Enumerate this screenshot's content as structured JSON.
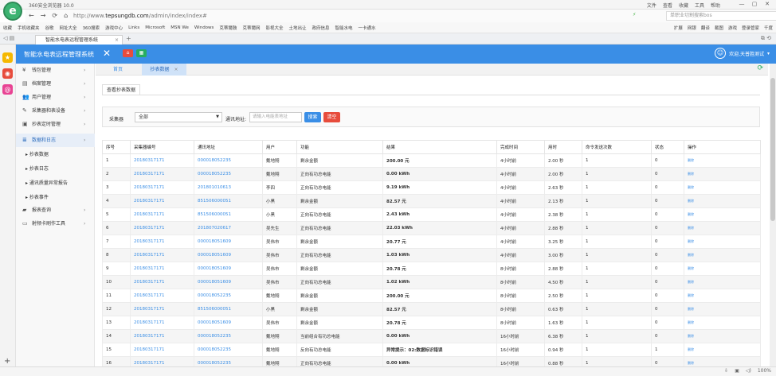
{
  "browser": {
    "name": "360安全浏览器 10.0",
    "menu": [
      "文件",
      "查看",
      "收藏",
      "工具",
      "帮助"
    ],
    "url_prefix": "http://www.",
    "url_domain": "tepsungdb.com",
    "url_path": "/admin/index/index#",
    "search_placeholder": "单职业切割搜索bos",
    "favorites": [
      "收藏",
      "手机收藏夹",
      "谷歌",
      "网址大全",
      "360搜索",
      "游戏中心",
      "Links",
      "Microsoft",
      "MSN We",
      "Windows",
      "克蒂爾鼓",
      "克蒂爾网",
      "影视大全",
      "土地出让",
      "政府信息",
      "智能水电",
      "一卡通水"
    ],
    "fav_right": [
      "扩展",
      "网银",
      "翻译",
      "截图",
      "游戏",
      "登录管家",
      "千度"
    ],
    "tab_label": "智能水电表远程管理系统",
    "zoom": "100%"
  },
  "app": {
    "title": "智能水电表远程管理系统",
    "user_greeting": "欢迎,天普胜测试"
  },
  "sidebar": {
    "items": [
      {
        "icon": "yen-icon",
        "label": "钱包管理"
      },
      {
        "icon": "doc-icon",
        "label": "档案管理"
      },
      {
        "icon": "users-icon",
        "label": "用户管理"
      },
      {
        "icon": "device-icon",
        "label": "采集器和表设备"
      },
      {
        "icon": "clock-icon",
        "label": "抄表定时管理"
      },
      {
        "icon": "log-icon",
        "label": "数据和日志"
      }
    ],
    "subitems": [
      "抄表数据",
      "抄表日志",
      "通讯质量异常报告",
      "抄表事件"
    ],
    "items2": [
      {
        "icon": "report-icon",
        "label": "报表查询"
      },
      {
        "icon": "card-icon",
        "label": "射频卡刷作工具"
      }
    ]
  },
  "content_tabs": [
    "首页",
    "抄表数据"
  ],
  "subtab": "查看抄表数据",
  "filter": {
    "collector_label": "采集器",
    "collector_value": "全部",
    "address_label": "通讯地址:",
    "address_placeholder": "请输入电能表地址",
    "search_button": "搜索",
    "clear_button": "清空"
  },
  "table": {
    "headers": [
      "序号",
      "采集器编号",
      "通讯地址",
      "用户",
      "功能",
      "结果",
      "完成时间",
      "用时",
      "命令发送次数",
      "状态",
      "操作"
    ],
    "op_label": "删除",
    "rows": [
      [
        "1",
        "20180317171",
        "000018052235",
        "戴地翔",
        "剩余金额",
        "200.00 元",
        "4小时前",
        "2.00 秒",
        "1",
        "0"
      ],
      [
        "2",
        "20180317171",
        "000018052235",
        "戴地翔",
        "正向有功总电能",
        "0.00 kWh",
        "4小时前",
        "2.00 秒",
        "1",
        "0"
      ],
      [
        "3",
        "20180317171",
        "201801010613",
        "李四",
        "正向有功总电能",
        "9.19 kWh",
        "4小时前",
        "2.63 秒",
        "1",
        "0"
      ],
      [
        "4",
        "20180317171",
        "851506000051",
        "小黑",
        "剩余金额",
        "82.57 元",
        "4小时前",
        "2.13 秒",
        "1",
        "0"
      ],
      [
        "5",
        "20180317171",
        "851506000051",
        "小黑",
        "正向有功总电能",
        "2.43 kWh",
        "4小时前",
        "2.38 秒",
        "1",
        "0"
      ],
      [
        "6",
        "20180317171",
        "201807020617",
        "吴先生",
        "正向有功总电能",
        "22.03 kWh",
        "4小时前",
        "2.88 秒",
        "1",
        "0"
      ],
      [
        "7",
        "20180317171",
        "000018051609",
        "吴伟市",
        "剩余金额",
        "20.77 元",
        "4小时前",
        "3.25 秒",
        "1",
        "0"
      ],
      [
        "8",
        "20180317171",
        "000018051609",
        "吴伟市",
        "正向有功总电能",
        "1.03 kWh",
        "4小时前",
        "3.00 秒",
        "1",
        "0"
      ],
      [
        "9",
        "20180317171",
        "000018051609",
        "吴伟市",
        "剩余金额",
        "20.78 元",
        "8小时前",
        "2.88 秒",
        "1",
        "0"
      ],
      [
        "10",
        "20180317171",
        "000018051609",
        "吴伟市",
        "正向有功总电能",
        "1.02 kWh",
        "8小时前",
        "4.50 秒",
        "1",
        "0"
      ],
      [
        "11",
        "20180317171",
        "000018052235",
        "戴地翔",
        "剩余金额",
        "200.00 元",
        "8小时前",
        "2.50 秒",
        "1",
        "0"
      ],
      [
        "12",
        "20180317171",
        "851506000051",
        "小黑",
        "剩余金额",
        "82.57 元",
        "8小时前",
        "0.63 秒",
        "1",
        "0"
      ],
      [
        "13",
        "20180317171",
        "000018051609",
        "吴伟市",
        "剩余金额",
        "20.78 元",
        "8小时前",
        "1.63 秒",
        "1",
        "0"
      ],
      [
        "14",
        "20180317171",
        "000018052235",
        "戴地翔",
        "当前组合有功总电能",
        "0.00 kWh",
        "16小时前",
        "6.38 秒",
        "1",
        "0"
      ],
      [
        "15",
        "20180317171",
        "000018052235",
        "戴地翔",
        "反向有功总电能",
        "异常提示：02:数据标识错误",
        "16小时前",
        "0.94 秒",
        "1",
        "1"
      ],
      [
        "16",
        "20180317171",
        "000018052235",
        "戴地翔",
        "正向有功总电能",
        "0.00 kWh",
        "16小时前",
        "0.88 秒",
        "1",
        "0"
      ]
    ]
  }
}
